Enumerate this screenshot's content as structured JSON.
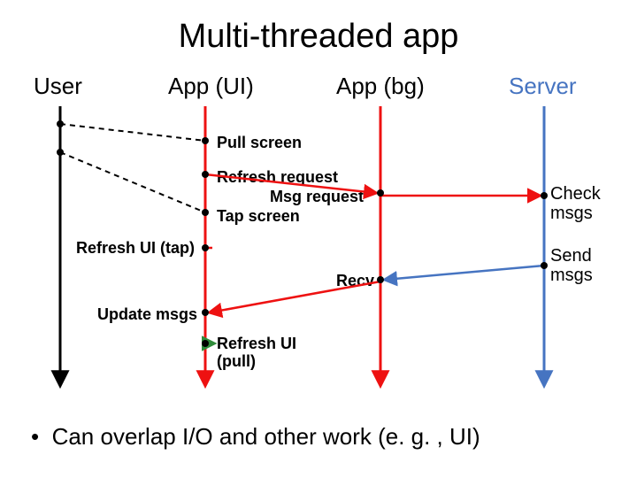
{
  "title": "Multi-threaded app",
  "lanes": {
    "user": "User",
    "appui": "App (UI)",
    "appbg": "App (bg)",
    "server": "Server"
  },
  "events": {
    "pull_screen": "Pull screen",
    "refresh_request": "Refresh request",
    "msg_request": "Msg request",
    "tap_screen": "Tap screen",
    "refresh_ui_tap": "Refresh UI (tap)",
    "recv": "Recv",
    "update_msgs": "Update msgs",
    "refresh_ui_pull": "Refresh UI (pull)"
  },
  "side": {
    "check_msgs": "Check msgs",
    "send_msgs": "Send msgs"
  },
  "bullet": "Can overlap I/O and other work (e. g. , UI)"
}
